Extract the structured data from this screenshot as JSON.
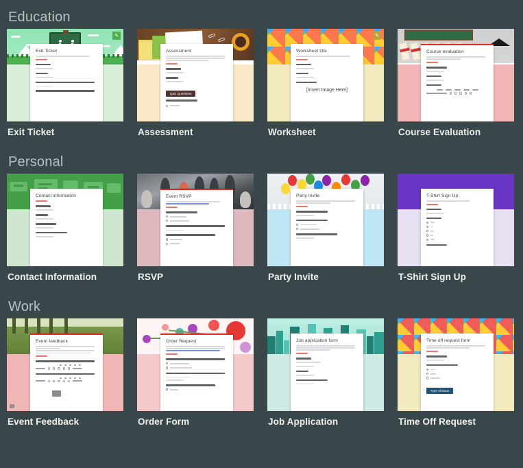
{
  "sections": [
    {
      "title": "Education",
      "cards": [
        {
          "title": "Exit Ticket",
          "form_title": "Exit Ticket",
          "badge_icon": "pencil-icon",
          "badge_glyph": "✎",
          "badge_color": "#4caf50",
          "accent": "#4caf50",
          "questions": [
            "Name",
            "Email",
            "Name one important thing you learned in class today.",
            "Did you feel prepared for today's lesson? Why or why not?"
          ]
        },
        {
          "title": "Assessment",
          "form_title": "Assessment",
          "accent": "#5d4037",
          "pill_label": "Quiz Questions",
          "pill_color": "#4e342e",
          "questions": [
            "Name",
            "Email",
            "Your first question?"
          ]
        },
        {
          "title": "Worksheet",
          "form_title": "Worksheet title",
          "badge_icon": "pencil-icon",
          "badge_glyph": "✎",
          "badge_color": "#c0a23a",
          "accent": "#d93025",
          "insert_text": "[Insert Image Here]",
          "questions": [
            "Name",
            "Email",
            "Image title"
          ]
        },
        {
          "title": "Course Evaluation",
          "form_title": "Course evaluation",
          "accent": "#d93025",
          "grid_columns": [
            "Poor",
            "Fair",
            "Satisfactory",
            "Very good",
            "Excellent"
          ],
          "questions": [
            "Class name",
            "Instructor",
            "Level of effort"
          ]
        }
      ]
    },
    {
      "title": "Personal",
      "cards": [
        {
          "title": "Contact Information",
          "form_title": "Contact information",
          "accent": "#43a047",
          "questions": [
            "Name",
            "Email",
            "Address",
            "Phone number"
          ]
        },
        {
          "title": "RSVP",
          "form_title": "Event RSVP",
          "accent": "#d93025",
          "questions": [
            "Can you attend?",
            "What are the names of people attending?",
            "How did you hear about this event?"
          ],
          "options": [
            "Yes, I'll be there",
            "Sorry, can't make it"
          ]
        },
        {
          "title": "Party Invite",
          "form_title": "Party Invite",
          "accent": "#d93025",
          "questions": [
            "What is your name?",
            "Can you attend?",
            "How many of you are attending?"
          ],
          "options": [
            "Yes, I'll be there",
            "Sorry, can't make it"
          ]
        },
        {
          "title": "T-Shirt Sign Up",
          "form_title": "T-Shirt Sign Up",
          "accent": "#6a35c4",
          "questions": [
            "Name",
            "Shirt size",
            "T-Shirt Preview"
          ],
          "options": [
            "XS",
            "S",
            "M",
            "L",
            "XL"
          ]
        }
      ]
    },
    {
      "title": "Work",
      "cards": [
        {
          "title": "Event Feedback",
          "form_title": "Event feedback",
          "accent": "#d93025",
          "corner_icon": "image-icon",
          "questions": [
            "How satisfied were you with the event?",
            "How relevant and helpful do you think it was for your job?"
          ],
          "scale": [
            "1",
            "2",
            "3",
            "4",
            "5"
          ],
          "scale_low": "Not very",
          "scale_high": "Very much"
        },
        {
          "title": "Order Form",
          "form_title": "Order Request",
          "accent": "#d93025",
          "questions": [
            "Are you a new or existing customer?",
            "What is the item you would like to order?",
            "What color(s) would you like to order?"
          ],
          "options": [
            "I am a new customer",
            "I am an existing customer",
            "color 1"
          ]
        },
        {
          "title": "Job Application",
          "form_title": "Job application form",
          "accent": "#1f7f73",
          "questions": [
            "Name",
            "Email",
            "Phone number"
          ]
        },
        {
          "title": "Time Off Request",
          "form_title": "Time off request form",
          "accent": "#1a4f73",
          "pill_label": "Type of leave",
          "pill_color": "#215276",
          "questions": [
            "Leave date(s)",
            "AM/PM/All day"
          ],
          "options": [
            "AM",
            "PM",
            "Full day"
          ]
        }
      ]
    }
  ],
  "theme": {
    "background": "#39474a",
    "section_title_color": "#b9c2c3",
    "card_title_color": "#eef1f1"
  }
}
